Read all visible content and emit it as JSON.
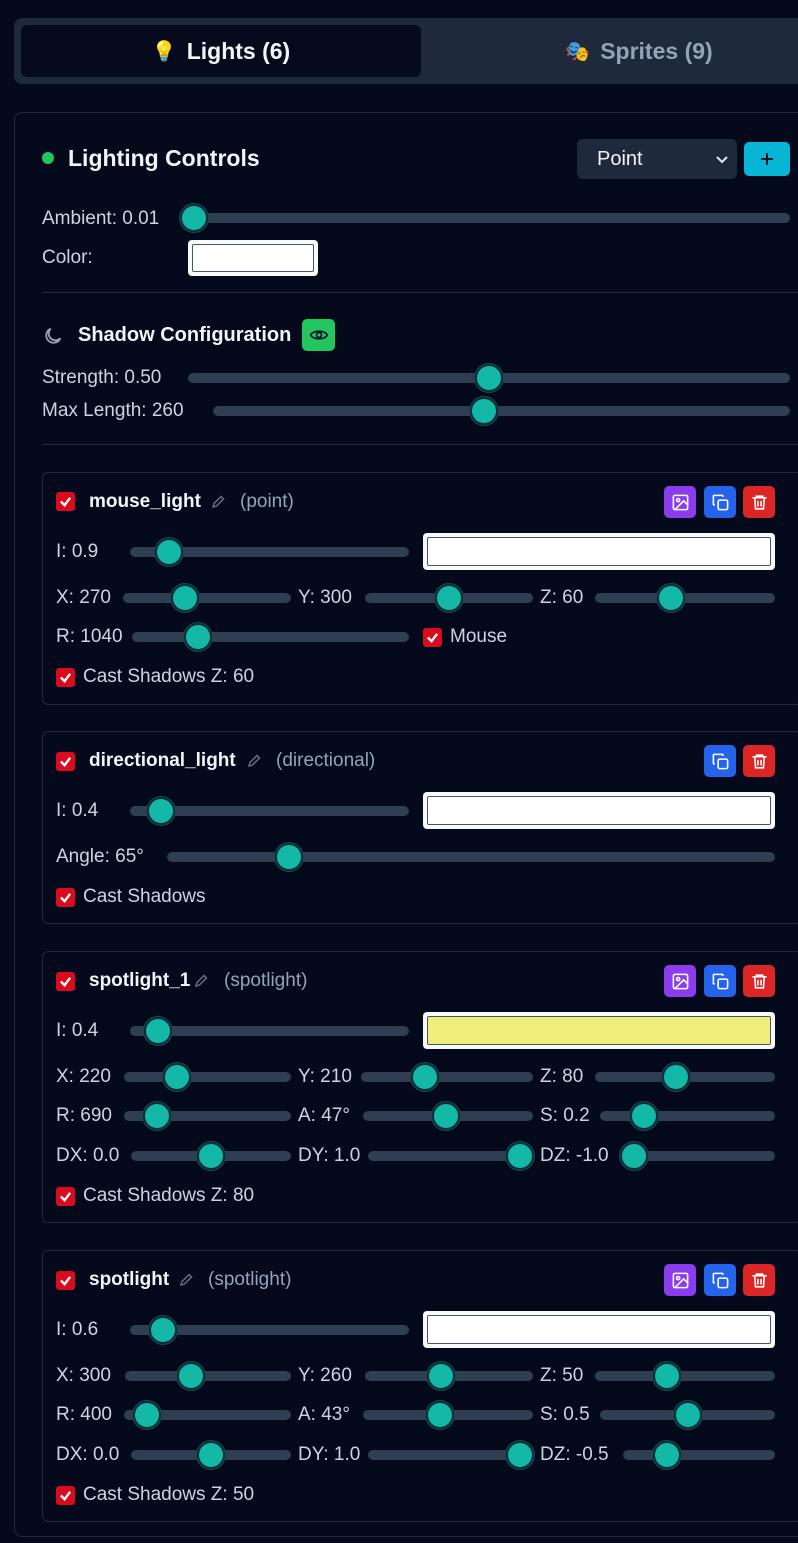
{
  "tabs": [
    {
      "icon": "💡",
      "label": "Lights (6)",
      "active": true
    },
    {
      "icon": "🎭",
      "label": "Sprites (9)",
      "active": false
    }
  ],
  "lighting": {
    "title": "Lighting Controls",
    "status_color": "#22c55e",
    "type_select": {
      "value": "Point"
    },
    "add_icon": "plus-icon",
    "ambient_label": "Ambient: 0.01",
    "ambient_value": 0.01,
    "color_label": "Color:",
    "color_value": "#ffffff"
  },
  "shadow": {
    "title": "Shadow Configuration",
    "icon": "moon-icon",
    "toggle_icon": "eye-icon",
    "strength_label": "Strength: 0.50",
    "strength_value": 0.5,
    "max_length_label": "Max Length: 260",
    "max_length_value": 0.47
  },
  "lights": [
    {
      "name": "mouse_light",
      "type": "(point)",
      "enabled": true,
      "actions": [
        "image-icon",
        "copy-icon",
        "trash-icon"
      ],
      "intensity_label": "I: 0.9",
      "intensity_pos": 0.14,
      "color": "#ffffff",
      "x_label": "X: 270",
      "x_pos": 0.37,
      "y_label": "Y: 300",
      "y_pos": 0.5,
      "z_label": "Z: 60",
      "z_pos": 0.42,
      "r_label": "R: 1040",
      "r_pos": 0.24,
      "mouse_label": "Mouse",
      "mouse_checked": true,
      "cast_label": "Cast Shadows Z: 60",
      "cast_checked": true
    },
    {
      "name": "directional_light",
      "type": "(directional)",
      "enabled": true,
      "actions": [
        "copy-icon",
        "trash-icon"
      ],
      "intensity_label": "I: 0.4",
      "intensity_pos": 0.11,
      "color": "#ffffff",
      "angle_label": "Angle: 65°",
      "angle_pos": 0.2,
      "cast_label": "Cast Shadows",
      "cast_checked": true
    },
    {
      "name": "spotlight_1",
      "type": "(spotlight)",
      "enabled": true,
      "actions": [
        "image-icon",
        "copy-icon",
        "trash-icon"
      ],
      "intensity_label": "I: 0.4",
      "intensity_pos": 0.1,
      "color": "#f0ee7a",
      "x_label": "X: 220",
      "x_pos": 0.32,
      "y_label": "Y: 210",
      "y_pos": 0.37,
      "z_label": "Z: 80",
      "z_pos": 0.45,
      "r_label": "R: 690",
      "r_pos": 0.2,
      "a_label": "A: 47°",
      "a_pos": 0.49,
      "s_label": "S: 0.2",
      "s_pos": 0.25,
      "dx_label": "DX: 0.0",
      "dx_pos": 0.5,
      "dy_label": "DY: 1.0",
      "dy_pos": 0.98,
      "dz_label": "DZ: -1.0",
      "dz_pos": 0.07,
      "cast_label": "Cast Shadows Z: 80",
      "cast_checked": true
    },
    {
      "name": "spotlight",
      "type": "(spotlight)",
      "enabled": true,
      "actions": [
        "image-icon",
        "copy-icon",
        "trash-icon"
      ],
      "intensity_label": "I: 0.6",
      "intensity_pos": 0.12,
      "color": "#ffffff",
      "x_label": "X: 300",
      "x_pos": 0.4,
      "y_label": "Y: 260",
      "y_pos": 0.45,
      "z_label": "Z: 50",
      "z_pos": 0.4,
      "r_label": "R: 400",
      "r_pos": 0.14,
      "a_label": "A: 43°",
      "a_pos": 0.45,
      "s_label": "S: 0.5",
      "s_pos": 0.5,
      "dx_label": "DX: 0.0",
      "dx_pos": 0.5,
      "dy_label": "DY: 1.0",
      "dy_pos": 0.98,
      "dz_label": "DZ: -0.5",
      "dz_pos": 0.29,
      "cast_label": "Cast Shadows Z: 50",
      "cast_checked": true
    }
  ]
}
